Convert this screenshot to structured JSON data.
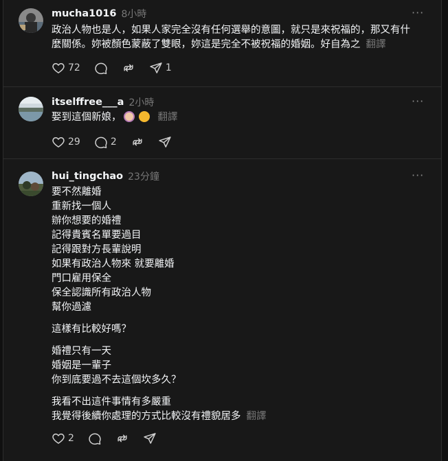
{
  "posts": [
    {
      "username": "mucha1016",
      "time": "8小時",
      "more": "···",
      "lines": [
        "政治人物也是人，如果人家完全沒有任何選舉的意圖，就只是來祝福的，那又有什",
        "麼關係。妳被顏色蒙蔽了雙眼，妳這是完全不被祝福的婚姻。好自為之"
      ],
      "translate": "翻譯",
      "likes": "72",
      "replies": "",
      "shares": "1"
    },
    {
      "username": "itselffree___a",
      "time": "2小時",
      "more": "···",
      "line": "娶到這個新娘，",
      "translate": "翻譯",
      "likes": "29",
      "replies": "2",
      "shares": ""
    },
    {
      "username": "hui_tingchao",
      "time": "23分鐘",
      "more": "···",
      "para1": [
        "要不然離婚",
        "重新找一個人",
        "辦你想要的婚禮",
        "記得貴賓名單要過目",
        "記得跟對方長輩說明",
        "如果有政治人物來 就要離婚",
        "門口雇用保全",
        "保全認識所有政治人物",
        "幫你過濾"
      ],
      "para2": [
        "這樣有比較好嗎？"
      ],
      "para3": [
        "婚禮只有一天",
        "婚姻是一輩子",
        "你到底要過不去這個坎多久？"
      ],
      "para4": [
        "我看不出這件事情有多嚴重",
        "我覺得後續你處理的方式比較沒有禮貌居多"
      ],
      "translate": "翻譯",
      "likes": "2",
      "replies": "",
      "shares": ""
    }
  ],
  "icons": [
    "heart-icon",
    "comment-icon",
    "repost-icon",
    "share-icon",
    "more-icon",
    "facepalm-emoji",
    "pleading-emoji"
  ],
  "colors": {
    "background": "#181818",
    "text": "#f3f5f7",
    "muted": "#777777",
    "divider": "#2d2d2d"
  }
}
